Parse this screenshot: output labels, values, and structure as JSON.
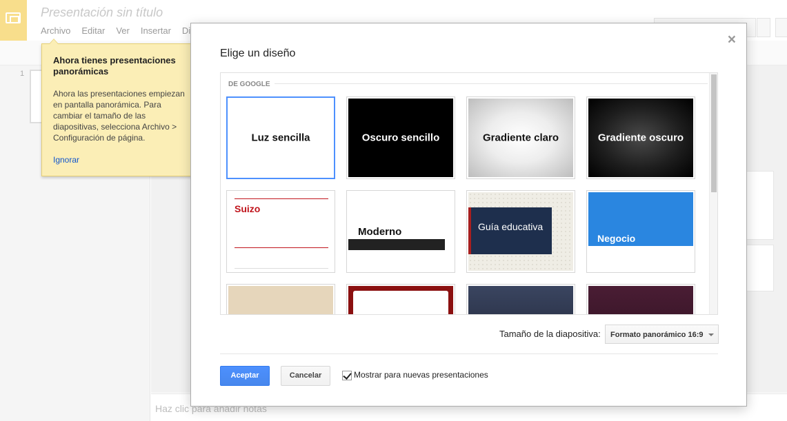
{
  "app": {
    "doc_title": "Presentación sin título",
    "menu": [
      "Archivo",
      "Editar",
      "Ver",
      "Insertar",
      "Di"
    ],
    "notes_placeholder": "Haz clic para añadir notas",
    "slide_number": "1"
  },
  "tooltip": {
    "title": "Ahora tienes presentaciones panorámicas",
    "body": "Ahora las presentaciones empiezan en pantalla panorámica. Para cambiar el tamaño de las diapositivas, selecciona Archivo > Configuración de página.",
    "dismiss": "Ignorar"
  },
  "dialog": {
    "title": "Elige un diseño",
    "close": "×",
    "section_label": "DE GOOGLE",
    "themes": [
      {
        "label": "Luz sencilla",
        "selected": true
      },
      {
        "label": "Oscuro sencillo"
      },
      {
        "label": "Gradiente claro"
      },
      {
        "label": "Gradiente oscuro"
      },
      {
        "label": "Suizo"
      },
      {
        "label": "Moderno"
      },
      {
        "label": "Guía educativa"
      },
      {
        "label": "Negocio"
      },
      {
        "label": ""
      },
      {
        "label": ""
      },
      {
        "label": ""
      },
      {
        "label": ""
      }
    ],
    "size_label": "Tamaño de la diapositiva:",
    "size_value": "Formato panorámico 16:9",
    "accept": "Aceptar",
    "cancel": "Cancelar",
    "show_checkbox_label": "Mostrar para nuevas presentaciones",
    "show_checkbox_checked": true
  },
  "colors": {
    "accent_blue": "#4d90fe",
    "tooltip_bg": "#fbeeb6",
    "swiss_red": "#c0141c",
    "business_blue": "#2a86e0"
  }
}
